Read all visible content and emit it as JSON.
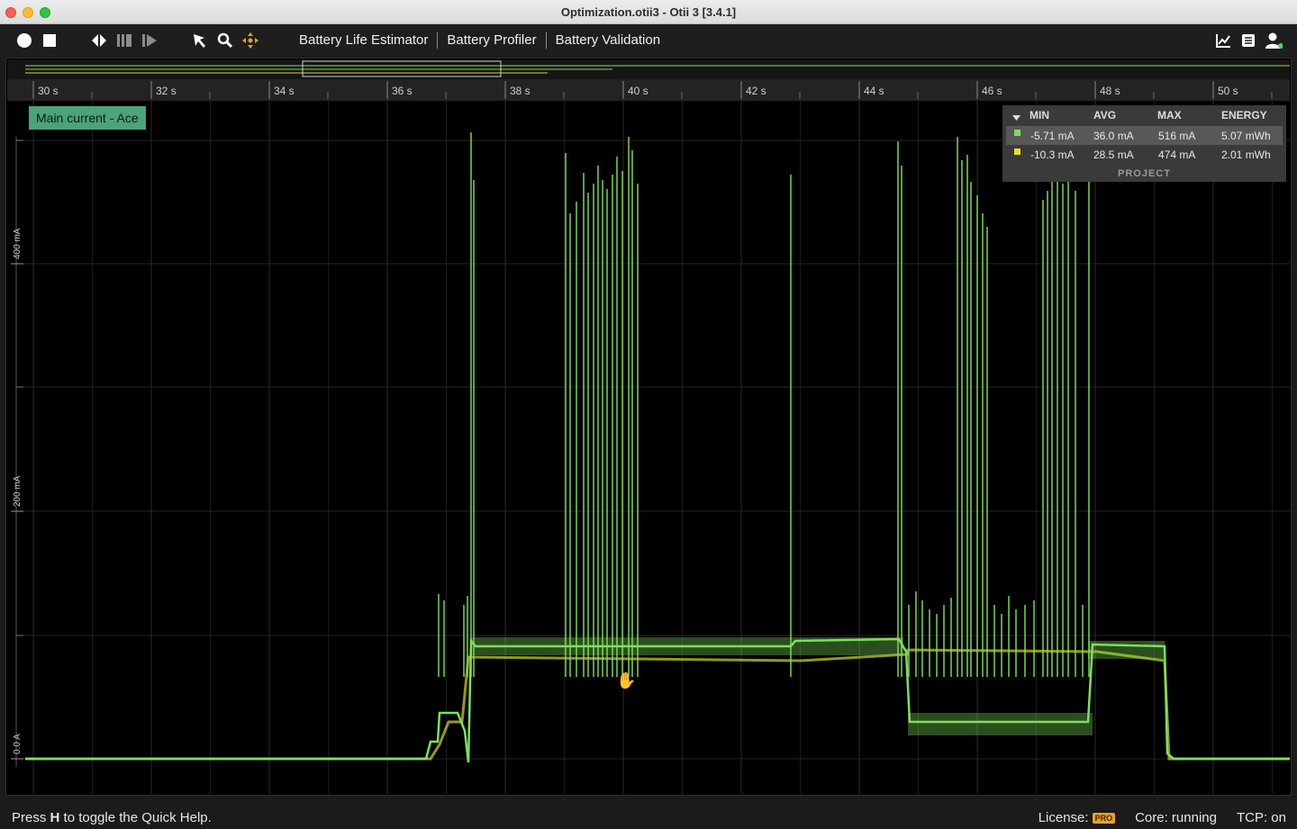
{
  "window": {
    "title": "Optimization.otii3 - Otii 3 [3.4.1]"
  },
  "toolbar": {
    "icons": [
      "record-icon",
      "stop-icon",
      "fit-width-icon",
      "columns-icon",
      "play-skip-icon",
      "pointer-icon",
      "zoom-icon",
      "pan-icon"
    ],
    "menu": [
      "Battery Life Estimator",
      "Battery Profiler",
      "Battery Validation"
    ],
    "right_icons": [
      "chart-icon",
      "list-icon",
      "user-icon"
    ],
    "accent": "#e8a31c"
  },
  "plot": {
    "series_label": "Main current - Ace",
    "y_axis_labels": [
      "400 mA",
      "200 mA",
      "0.0 A"
    ],
    "x_tick_labels": [
      "30 s",
      "32 s",
      "34 s",
      "36 s",
      "38 s",
      "40 s",
      "42 s",
      "44 s",
      "46 s",
      "48 s",
      "50 s"
    ],
    "colors": {
      "series_a": "#7ee05a",
      "series_b": "#d7d72a",
      "grid": "#2a2a2a",
      "tag": "#4aa37c"
    }
  },
  "stats": {
    "headers": [
      "MIN",
      "AVG",
      "MAX",
      "ENERGY"
    ],
    "rows": [
      {
        "min": "-5.71 mA",
        "avg": "36.0 mA",
        "max": "516 mA",
        "energy": "5.07 mWh",
        "color": "#7ee05a"
      },
      {
        "min": "-10.3 mA",
        "avg": "28.5 mA",
        "max": "474 mA",
        "energy": "2.01 mWh",
        "color": "#e6e02a"
      }
    ],
    "footer": "PROJECT"
  },
  "status": {
    "hint_pre": "Press ",
    "hint_key": "H",
    "hint_post": " to toggle the Quick Help.",
    "license_label": "License:",
    "license_badge": "PRO",
    "core": "Core: running",
    "tcp": "TCP: on"
  }
}
